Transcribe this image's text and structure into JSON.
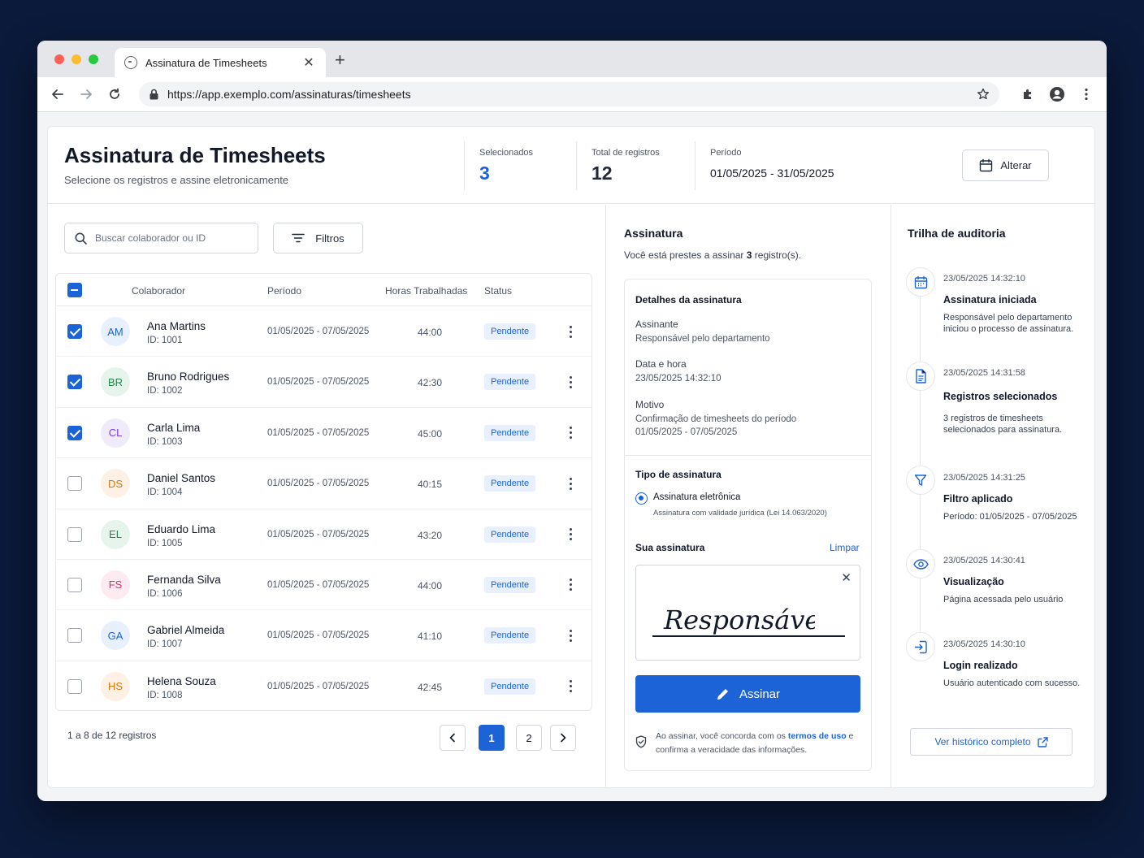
{
  "browser": {
    "tab_title": "Assinatura de Timesheets",
    "url": "https://app.exemplo.com/assinaturas/timesheets"
  },
  "header": {
    "title": "Assinatura de Timesheets",
    "subtitle": "Selecione os registros e assine eletronicamente",
    "stats": {
      "selected_label": "Selecionados",
      "selected_value": "3",
      "total_label": "Total de registros",
      "total_value": "12",
      "period_label": "Período",
      "period_value": "01/05/2025 - 31/05/2025"
    },
    "change_button": "Alterar"
  },
  "toolbar": {
    "search_placeholder": "Buscar colaborador ou ID",
    "filters_label": "Filtros"
  },
  "table": {
    "columns": [
      "Colaborador",
      "Período",
      "Horas Trabalhadas",
      "Status"
    ],
    "rows": [
      {
        "initials": "AM",
        "name": "Ana Martins",
        "id": "ID: 1001",
        "period": "01/05/2025 - 07/05/2025",
        "hours": "44:00",
        "status": "Pendente",
        "checked": true,
        "avatar_bg": "#e8f0fd",
        "avatar_fg": "#1d63d8"
      },
      {
        "initials": "BR",
        "name": "Bruno Rodrigues",
        "id": "ID: 1002",
        "period": "01/05/2025 - 07/05/2025",
        "hours": "42:30",
        "status": "Pendente",
        "checked": true,
        "avatar_bg": "#e6f4ec",
        "avatar_fg": "#1f8a4c"
      },
      {
        "initials": "CL",
        "name": "Carla Lima",
        "id": "ID: 1003",
        "period": "01/05/2025 - 07/05/2025",
        "hours": "45:00",
        "status": "Pendente",
        "checked": true,
        "avatar_bg": "#f0ebfa",
        "avatar_fg": "#7c3aed"
      },
      {
        "initials": "DS",
        "name": "Daniel Santos",
        "id": "ID: 1004",
        "period": "01/05/2025 - 07/05/2025",
        "hours": "40:15",
        "status": "Pendente",
        "checked": false,
        "avatar_bg": "#fdf0e4",
        "avatar_fg": "#d97706"
      },
      {
        "initials": "EL",
        "name": "Eduardo Lima",
        "id": "ID: 1005",
        "period": "01/05/2025 - 07/05/2025",
        "hours": "43:20",
        "status": "Pendente",
        "checked": false,
        "avatar_bg": "#e6f4ec",
        "avatar_fg": "#1f8a4c"
      },
      {
        "initials": "FS",
        "name": "Fernanda Silva",
        "id": "ID: 1006",
        "period": "01/05/2025 - 07/05/2025",
        "hours": "44:00",
        "status": "Pendente",
        "checked": false,
        "avatar_bg": "#fdebf1",
        "avatar_fg": "#db2777"
      },
      {
        "initials": "GA",
        "name": "Gabriel Almeida",
        "id": "ID: 1007",
        "period": "01/05/2025 - 07/05/2025",
        "hours": "41:10",
        "status": "Pendente",
        "checked": false,
        "avatar_bg": "#e8f0fd",
        "avatar_fg": "#1d63d8"
      },
      {
        "initials": "HS",
        "name": "Helena Souza",
        "id": "ID: 1008",
        "period": "01/05/2025 - 07/05/2025",
        "hours": "42:45",
        "status": "Pendente",
        "checked": false,
        "avatar_bg": "#fdf0e4",
        "avatar_fg": "#d97706"
      }
    ]
  },
  "pagination": {
    "info": "1 a 8 de 12 registros",
    "pages": [
      "1",
      "2"
    ],
    "current": "1"
  },
  "signature": {
    "title": "Assinatura",
    "subtitle_pre": "Você está prestes a assinar ",
    "subtitle_count": "3",
    "subtitle_post": " registro(s).",
    "details_title": "Detalhes da assinatura",
    "signer_label": "Assinante",
    "signer_value": "Responsável pelo departamento",
    "datetime_label": "Data e hora",
    "datetime_value": "23/05/2025 14:32:10",
    "reason_label": "Motivo",
    "reason_line1": "Confirmação de timesheets do período",
    "reason_line2": "01/05/2025 - 07/05/2025",
    "type_title": "Tipo de assinatura",
    "type_option": "Assinatura eletrônica",
    "type_note": "Assinatura com validade jurídica (Lei 14.063/2020)",
    "your_signature": "Sua assinatura",
    "clear_label": "Limpar",
    "signature_text": "Responsável",
    "sign_button": "Assinar",
    "terms_pre": "Ao assinar, você concorda com os ",
    "terms_link": "termos de uso",
    "terms_post": " e confirma a veracidade das informações."
  },
  "audit": {
    "title": "Trilha de auditoria",
    "events": [
      {
        "icon": "calendar-icon",
        "timestamp": "23/05/2025 14:32:10",
        "title": "Assinatura iniciada",
        "desc": "Responsável pelo departamento iniciou o processo de assinatura."
      },
      {
        "icon": "document-icon",
        "timestamp": "23/05/2025 14:31:58",
        "title": "Registros selecionados",
        "desc": "3 registros de timesheets selecionados para assinatura."
      },
      {
        "icon": "filter-icon",
        "timestamp": "23/05/2025 14:31:25",
        "title": "Filtro aplicado",
        "desc": "Período: 01/05/2025 - 07/05/2025"
      },
      {
        "icon": "eye-icon",
        "timestamp": "23/05/2025 14:30:41",
        "title": "Visualização",
        "desc": "Página acessada pelo usuário"
      },
      {
        "icon": "login-icon",
        "timestamp": "23/05/2025 14:30:10",
        "title": "Login realizado",
        "desc": "Usuário autenticado com sucesso."
      }
    ],
    "history_button": "Ver histórico completo"
  },
  "colors": {
    "accent": "#1d63d8",
    "background": "#0b1a3a"
  }
}
